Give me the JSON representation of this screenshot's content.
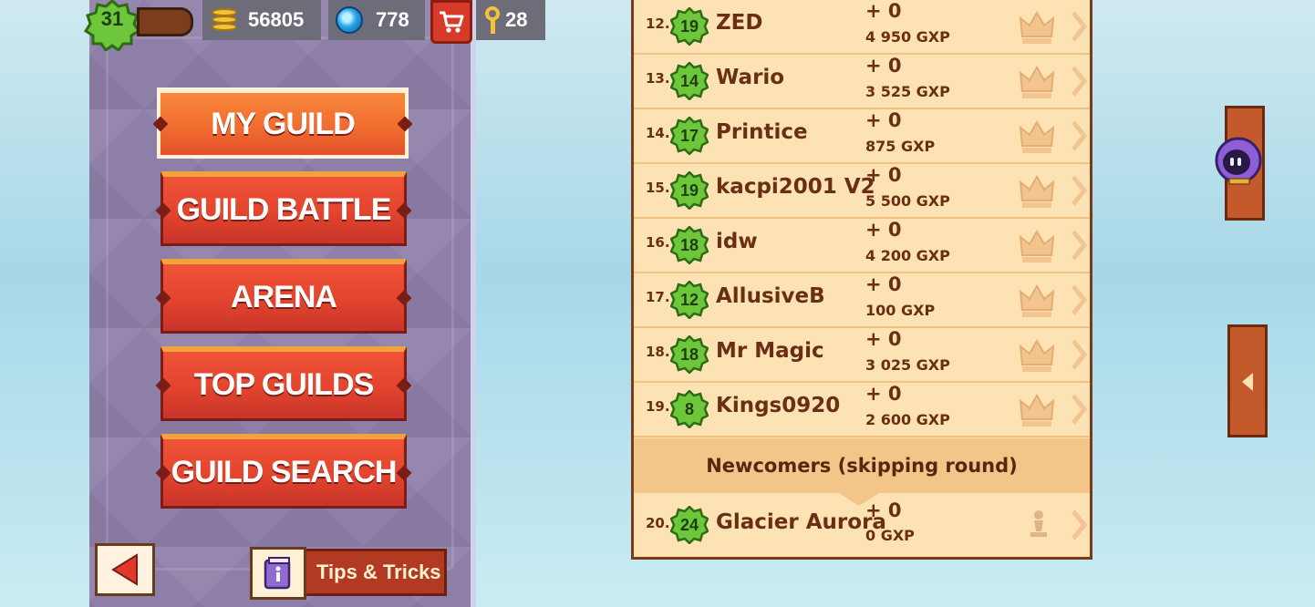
{
  "topbar": {
    "level": "31",
    "coins": "56805",
    "gems": "778",
    "keys": "28",
    "icons": [
      "level-badge-icon",
      "coin-stack-icon",
      "gem-icon",
      "cart-icon",
      "key-icon"
    ]
  },
  "menu": {
    "items": [
      {
        "label": "MY GUILD",
        "active": true
      },
      {
        "label": "GUILD BATTLE"
      },
      {
        "label": "ARENA"
      },
      {
        "label": "TOP GUILDS"
      },
      {
        "label": "GUILD SEARCH"
      }
    ]
  },
  "footer": {
    "tips_label": "Tips & Tricks"
  },
  "leaderboard": {
    "rows": [
      {
        "rank": "12.",
        "level": "19",
        "name": "ZED",
        "delta": "+ 0",
        "gxp": "4 950 GXP"
      },
      {
        "rank": "13.",
        "level": "14",
        "name": "Wario",
        "delta": "+ 0",
        "gxp": "3 525 GXP"
      },
      {
        "rank": "14.",
        "level": "17",
        "name": "Printice",
        "delta": "+ 0",
        "gxp": "875 GXP"
      },
      {
        "rank": "15.",
        "level": "19",
        "name": "kacpi2001 V2",
        "delta": "+ 0",
        "gxp": "5 500 GXP"
      },
      {
        "rank": "16.",
        "level": "18",
        "name": "idw",
        "delta": "+ 0",
        "gxp": "4 200 GXP"
      },
      {
        "rank": "17.",
        "level": "12",
        "name": "AllusiveB",
        "delta": "+ 0",
        "gxp": "100 GXP"
      },
      {
        "rank": "18.",
        "level": "18",
        "name": "Mr Magic",
        "delta": "+ 0",
        "gxp": "3 025 GXP"
      },
      {
        "rank": "19.",
        "level": "8",
        "name": "Kings0920",
        "delta": "+ 0",
        "gxp": "2 600 GXP"
      }
    ],
    "newcomers_header": "Newcomers (skipping round)",
    "newcomers": [
      {
        "rank": "20.",
        "level": "24",
        "name": "Glacier Aurora",
        "delta": "+ 0",
        "gxp": "0 GXP"
      }
    ]
  },
  "colors": {
    "menu_red": "#e2442d",
    "menu_active": "#f06a2f",
    "board_bg": "#fde2b3",
    "text_brown": "#6a2e14",
    "badge_green": "#5fb330"
  }
}
